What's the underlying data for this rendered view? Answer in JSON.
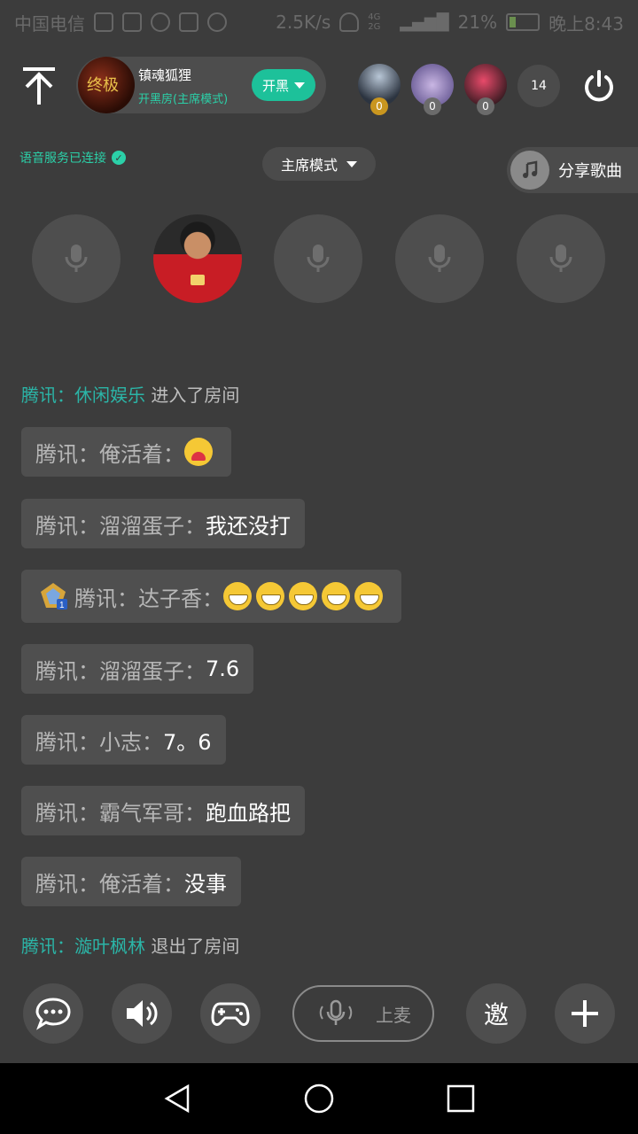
{
  "status_bar": {
    "carrier": "中国电信",
    "net_speed": "2.5K/s",
    "signal_tag": "4G 2G",
    "battery": "21%",
    "time": "晚上8:43"
  },
  "header": {
    "room_avatar_text": "终极",
    "room_name": "镇魂狐狸",
    "room_mode": "开黑房(主席模式)",
    "open_button": "开黑",
    "listeners": [
      {
        "badge": "0",
        "badge_color": "#c9961f",
        "bg": "radial-gradient(circle at 50% 30%, #b8c6d6, #2c3440 70%)"
      },
      {
        "badge": "0",
        "badge_color": "#6b6b6b",
        "bg": "radial-gradient(circle at 50% 50%, #c9b6e3, #6a5c96 80%)"
      },
      {
        "badge": "0",
        "badge_color": "#6b6b6b",
        "bg": "radial-gradient(circle at 45% 40%, #e84a6a, #3a1b22 75%)"
      }
    ],
    "listener_count": "14"
  },
  "voice": {
    "status": "语音服务已连接",
    "mode_select": "主席模式",
    "share_song": "分享歌曲"
  },
  "chat": {
    "enter": {
      "name": "腾讯：休闲娱乐",
      "action": "进入了房间"
    },
    "messages": [
      {
        "who": "腾讯：俺活着：",
        "text": ""
      },
      {
        "who": "腾讯：溜溜蛋子：",
        "text": "我还没打"
      },
      {
        "who": "腾讯：达子香：",
        "text": ""
      },
      {
        "who": "腾讯：溜溜蛋子：",
        "text": "7.6"
      },
      {
        "who": "腾讯：小志：",
        "text": "7。6"
      },
      {
        "who": "腾讯：霸气军哥：",
        "text": "跑血路把"
      },
      {
        "who": "腾讯：俺活着：",
        "text": "没事"
      }
    ],
    "exit": {
      "name": "腾讯：漩叶枫林",
      "action": "退出了房间"
    }
  },
  "bottom": {
    "mic_up": "上麦",
    "invite": "邀"
  },
  "colors": {
    "accent": "#1dc19a",
    "background": "#3c3c3c",
    "bubble": "#4f4f4f"
  }
}
